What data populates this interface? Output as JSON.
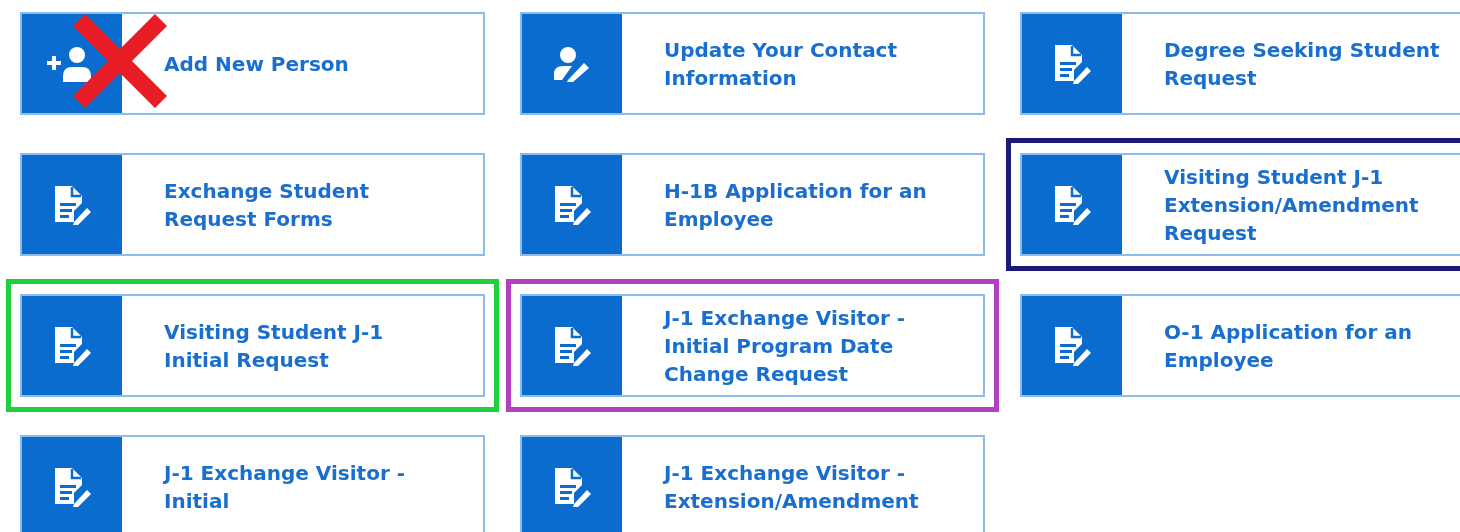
{
  "tiles": [
    {
      "label": "Add New Person",
      "kind": "person-add",
      "crossed": true
    },
    {
      "label": "Update Your Contact Information",
      "kind": "person-edit",
      "crossed": false
    },
    {
      "label": "Degree Seeking Student Request",
      "kind": "document-edit",
      "crossed": false
    },
    {
      "label": "Exchange Student Request Forms",
      "kind": "document-edit",
      "crossed": false
    },
    {
      "label": "H-1B Application for an Employee",
      "kind": "document-edit",
      "crossed": false
    },
    {
      "label": "Visiting Student J-1 Extension/Amendment Request",
      "kind": "document-edit",
      "crossed": false,
      "color": "#1a1a7a"
    },
    {
      "label": "Visiting Student J-1 Initial Request",
      "kind": "document-edit",
      "crossed": false,
      "color": "#1ed03c"
    },
    {
      "label": "J-1 Exchange Visitor - Initial Program Date Change Request",
      "kind": "document-edit",
      "crossed": false,
      "color": "#b040c0"
    },
    {
      "label": "O-1 Application for an Employee",
      "kind": "document-edit",
      "crossed": false
    },
    {
      "label": "J-1 Exchange Visitor - Initial",
      "kind": "document-edit",
      "crossed": false
    },
    {
      "label": "J-1 Exchange Visitor - Extension/Amendment",
      "kind": "document-edit",
      "crossed": false
    }
  ]
}
